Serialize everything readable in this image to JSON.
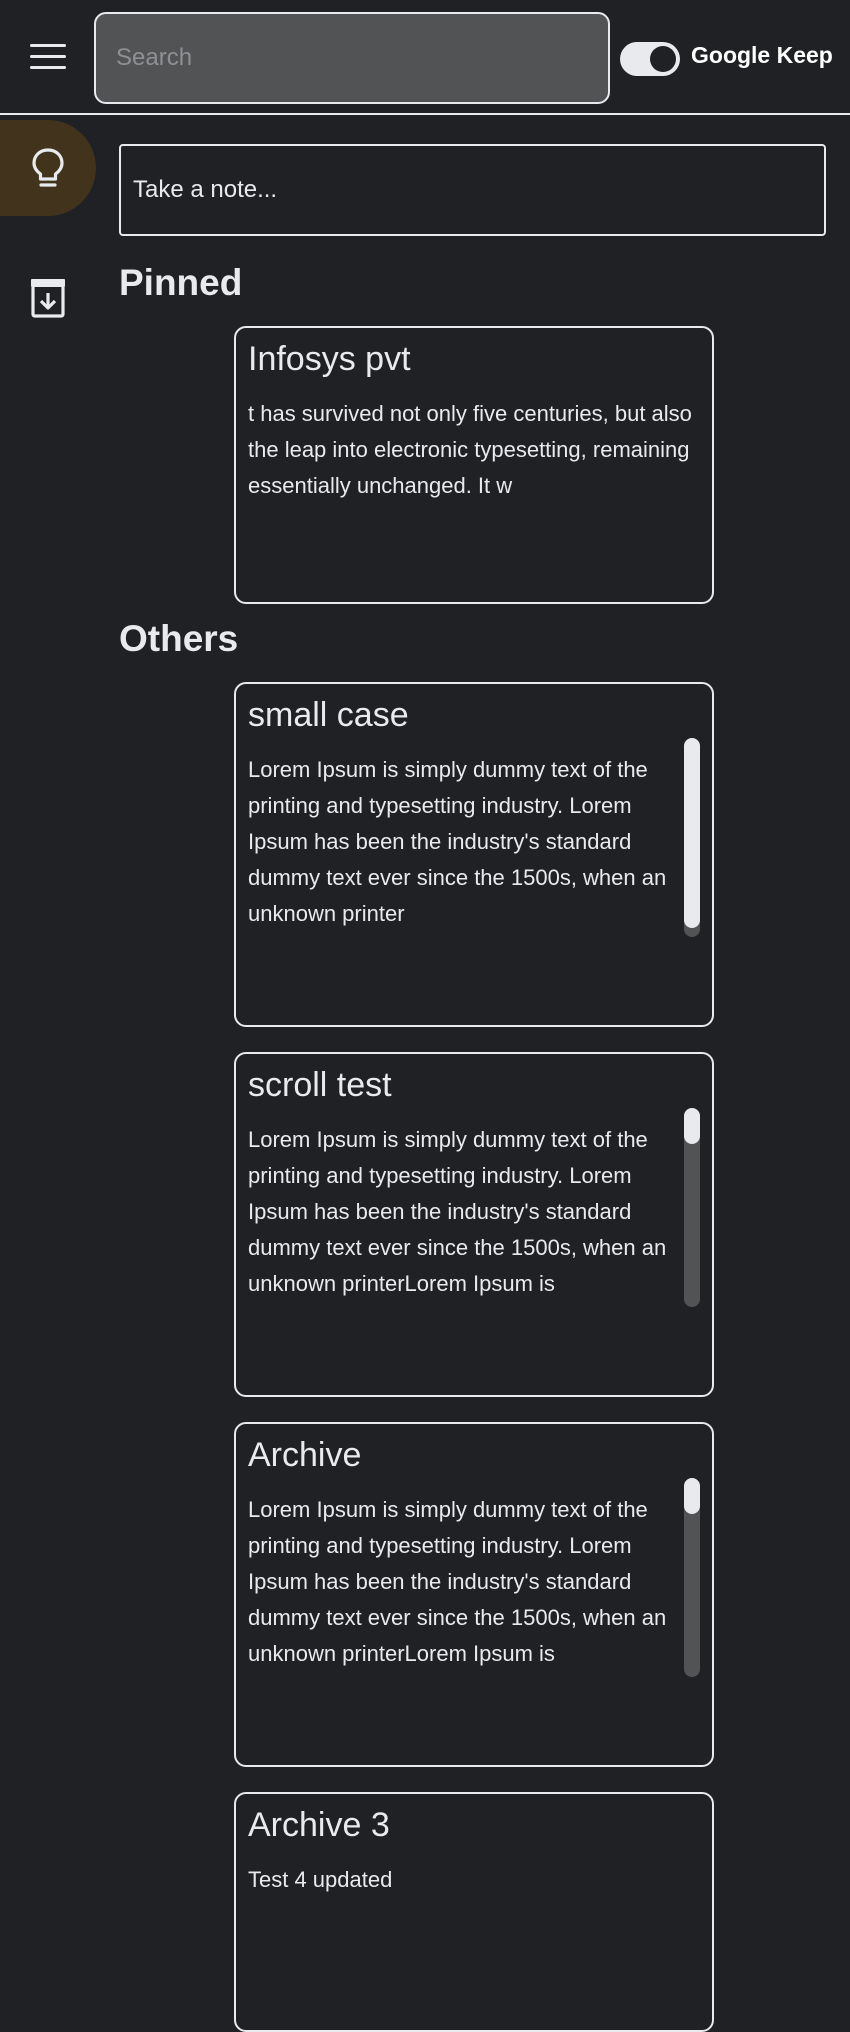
{
  "header": {
    "menu_icon": "hamburger-menu-icon",
    "search_placeholder": "Search",
    "brand": "Google Keep",
    "theme_toggle_on": true
  },
  "sidebar": {
    "items": [
      {
        "icon": "lightbulb-icon",
        "label": "Notes",
        "active": true
      },
      {
        "icon": "archive-icon",
        "label": "Archive",
        "active": false
      }
    ]
  },
  "take_note_placeholder": "Take a note...",
  "sections": {
    "pinned": "Pinned",
    "others": "Others"
  },
  "pinned_notes": [
    {
      "title": "Infosys pvt",
      "body": "t has survived not only five centuries, but also the leap into electronic typesetting, remaining essentially unchanged. It w"
    }
  ],
  "other_notes": [
    {
      "title": "small case",
      "body": "Lorem Ipsum is simply dummy text of the printing and typesetting industry. Lorem Ipsum has been the industry's standard dummy text ever since the 1500s, when an unknown printer",
      "scroll_fraction_visible": 1.0
    },
    {
      "title": "scroll test",
      "body": "Lorem Ipsum is simply dummy text of the printing and typesetting industry. Lorem Ipsum has been the industry's standard dummy text ever since the 1500s, when an unknown printerLorem Ipsum is",
      "scroll_fraction_visible": 0.18
    },
    {
      "title": "Archive",
      "body": "Lorem Ipsum is simply dummy text of the printing and typesetting industry. Lorem Ipsum has been the industry's standard dummy text ever since the 1500s, when an unknown printerLorem Ipsum is",
      "scroll_fraction_visible": 0.18
    },
    {
      "title": "Archive 3",
      "body": "Test 4 updated"
    }
  ],
  "colors": {
    "background": "#202124",
    "foreground": "#e8eaed",
    "active_nav": "#41331c",
    "search_bg": "#525355"
  }
}
